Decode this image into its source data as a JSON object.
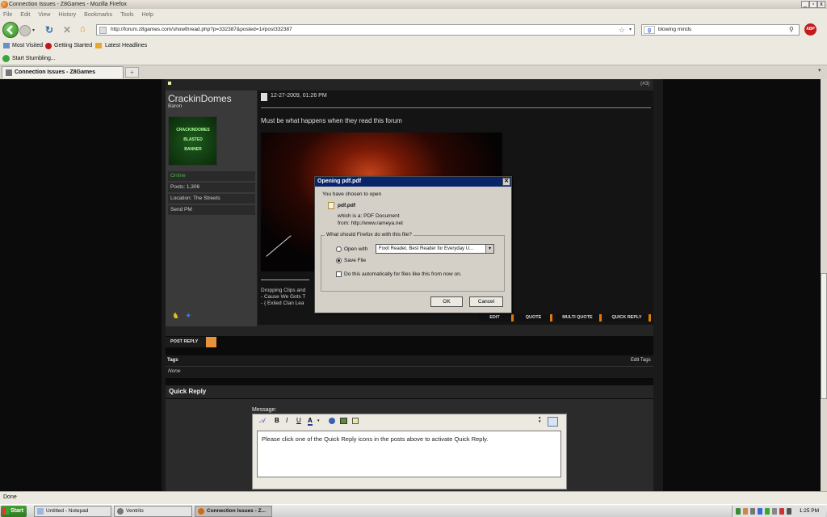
{
  "window": {
    "title": "Connection Issues - Z8Games - Mozilla Firefox"
  },
  "menu": [
    "File",
    "Edit",
    "View",
    "History",
    "Bookmarks",
    "Tools",
    "Help"
  ],
  "nav": {
    "url": "http://forum.z8games.com/showthread.php?p=332387&posted=1#post332387",
    "search_value": "blowing minds"
  },
  "bookmarks": [
    "Most Visited",
    "Getting Started",
    "Latest Headlines"
  ],
  "toolbar2": {
    "stumble": "Start Stumbling..."
  },
  "tabs": [
    {
      "label": "Connection Issues - Z8Games"
    }
  ],
  "post": {
    "number": "(#3)",
    "date": "12-27-2009, 01:26 PM",
    "username": "CrackinDomes",
    "rank": "Baron",
    "avatar_text": [
      "CRACKINDOMES",
      "BLASTED",
      "BANNER"
    ],
    "online": "Online",
    "posts": "Posts: 1,306",
    "location": "Location: The Streets",
    "send_pm": "Send PM",
    "message": "Must be what happens when they read this forum",
    "sig": [
      "Dropping Clips and",
      "- Cause We Gots T",
      "- { Exiled Clan Lea"
    ],
    "buttons": [
      "EDIT",
      "QUOTE",
      "MULTI QUOTE",
      "QUICK REPLY"
    ]
  },
  "thread": {
    "post_reply": "POST REPLY",
    "tags_label": "Tags",
    "edit_tags": "Edit Tags",
    "tags_value": "None",
    "quick_reply": "Quick Reply",
    "message_label": "Message:",
    "message_text": "Please click one of the Quick Reply icons in the posts above to activate Quick Reply."
  },
  "dialog": {
    "title": "Opening pdf.pdf",
    "intro": "You have chosen to open",
    "filename": "pdf.pdf",
    "which_is": "which is a:  PDF Document",
    "from": "from:  http://www.rameya.net",
    "group_label": "What should Firefox do with this file?",
    "open_with_label": "Open with",
    "open_with_value": "Foxit Reader, Best Reader for Everyday U...",
    "save_file_label": "Save File",
    "auto_label": "Do this automatically for files like this from now on.",
    "ok": "OK",
    "cancel": "Cancel"
  },
  "status": "Done",
  "taskbar": {
    "start": "Start",
    "items": [
      "Untitled - Notepad",
      "Ventrilo",
      "Connection Issues - Z..."
    ],
    "clock": "1:25 PM"
  }
}
